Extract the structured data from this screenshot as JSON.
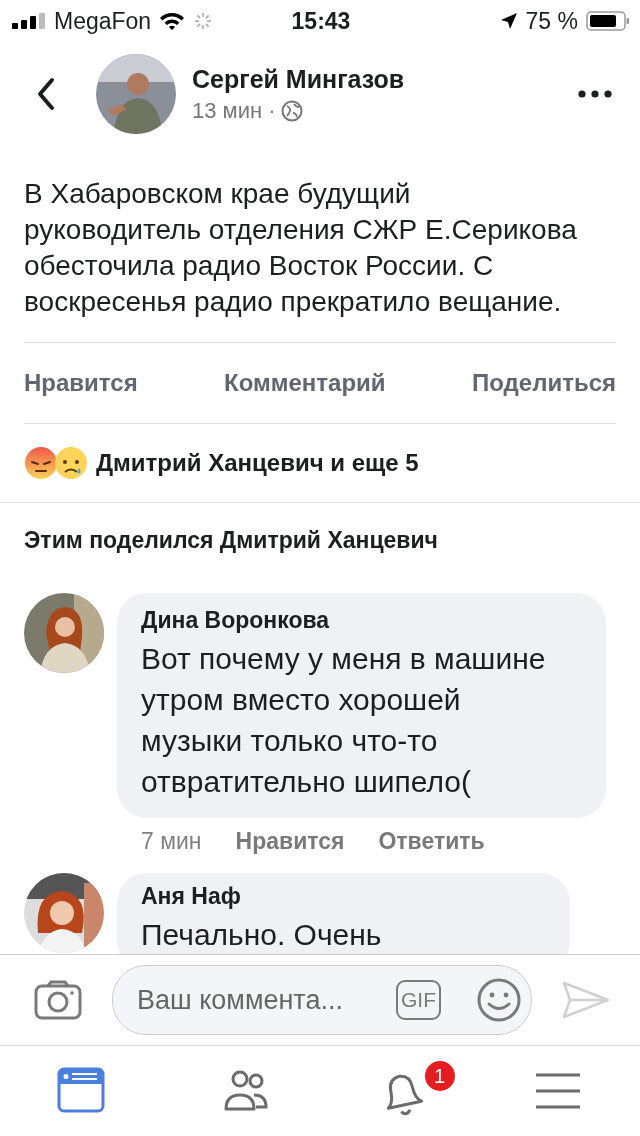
{
  "status_bar": {
    "carrier": "MegaFon",
    "time": "15:43",
    "battery_text": "75 %"
  },
  "post": {
    "author": "Сергей Мингазов",
    "time": "13 мин",
    "separator": "·",
    "text": "В Хабаровском крае будущий руководитель отделения СЖР Е.Серикова обесточила радио Восток России. С воскресенья радио прекратило вещание."
  },
  "actions": [
    "Нравится",
    "Комментарий",
    "Поделиться"
  ],
  "reactions": {
    "text": "Дмитрий Ханцевич и еще 5"
  },
  "shared_by": "Этим поделился Дмитрий Ханцевич",
  "comments": [
    {
      "author": "Дина Воронкова",
      "text": "Вот почему у меня в машине утром вместо хорошей музыки только что-то отвратительно шипело(",
      "time": "7 мин",
      "like": "Нравится",
      "reply": "Ответить"
    },
    {
      "author": "Аня Наф",
      "text": "Печально. Очень"
    }
  ],
  "composer": {
    "placeholder": "Ваш коммента...",
    "gif": "GIF"
  },
  "tabs": [
    {
      "kind": "feed",
      "selected": true
    },
    {
      "kind": "friends",
      "selected": false
    },
    {
      "kind": "notifications",
      "selected": false,
      "badge": "1"
    },
    {
      "kind": "menu",
      "selected": false
    }
  ]
}
